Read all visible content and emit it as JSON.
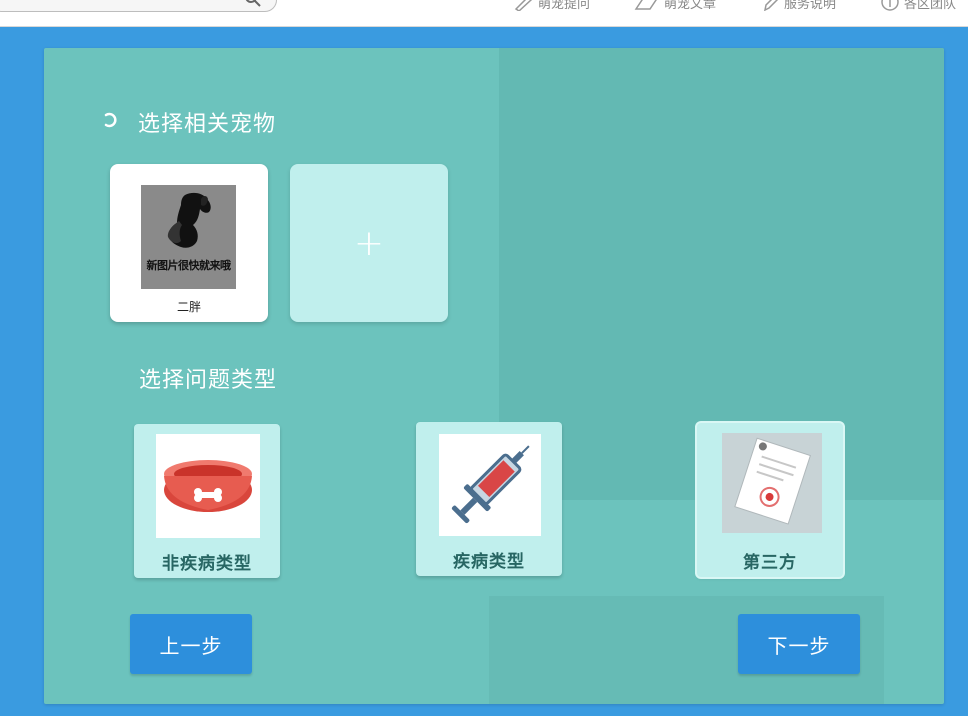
{
  "topbar": {
    "links": [
      {
        "label": "萌宠提问",
        "icon": "pen-icon"
      },
      {
        "label": "萌宠文章",
        "icon": "book-icon"
      },
      {
        "label": "服务说明",
        "icon": "pencil-icon"
      },
      {
        "label": "各区团队",
        "icon": "info-icon"
      }
    ]
  },
  "pets": {
    "title": "选择相关宠物",
    "items": [
      {
        "photo_caption": "新图片很快就来哦",
        "name": "二胖"
      }
    ],
    "add_symbol": "+"
  },
  "problem_types": {
    "title": "选择问题类型",
    "items": [
      {
        "label": "非疾病类型",
        "icon": "pet-bowl-icon",
        "selected": false
      },
      {
        "label": "疾病类型",
        "icon": "syringe-icon",
        "selected": false
      },
      {
        "label": "第三方",
        "icon": "document-icon",
        "selected": true
      }
    ]
  },
  "nav": {
    "prev_label": "上一步",
    "next_label": "下一步"
  },
  "colors": {
    "page_bg": "#3a9be0",
    "panel_bg": "#6cc3bd",
    "card_bg": "#c0efed",
    "button_bg": "#2d8fdc",
    "label_text": "#276663"
  }
}
